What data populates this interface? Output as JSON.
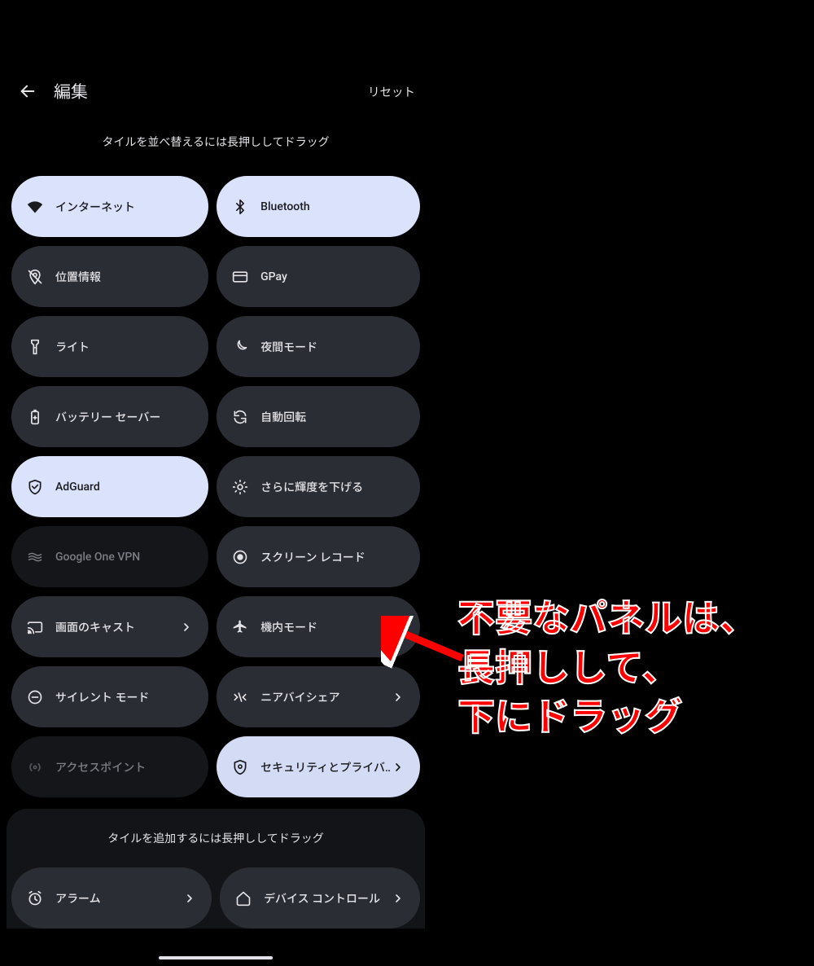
{
  "header": {
    "title": "編集",
    "reset": "リセット"
  },
  "hint_rearrange": "タイルを並べ替えるには長押ししてドラッグ",
  "section_add": {
    "hint": "タイルを追加するには長押ししてドラッグ"
  },
  "tiles": {
    "internet": "インターネット",
    "bluetooth": "Bluetooth",
    "location": "位置情報",
    "gpay": "GPay",
    "flashlight": "ライト",
    "night": "夜間モード",
    "battery": "バッテリー セーバー",
    "rotate": "自動回転",
    "adguard": "AdGuard",
    "dim": "さらに輝度を下げる",
    "vpn": "Google One VPN",
    "record": "スクリーン レコード",
    "cast": "画面のキャスト",
    "airplane": "機内モード",
    "silent": "サイレント モード",
    "nearby": "ニアバイシェア",
    "hotspot": "アクセスポイント",
    "security": "セキュリティとプライバ‥",
    "alarm": "アラーム",
    "device_ctrl": "デバイス コントロール"
  },
  "annotation": {
    "line1": "不要なパネルは、",
    "line2": "長押しして、",
    "line3": "下にドラッグ"
  }
}
